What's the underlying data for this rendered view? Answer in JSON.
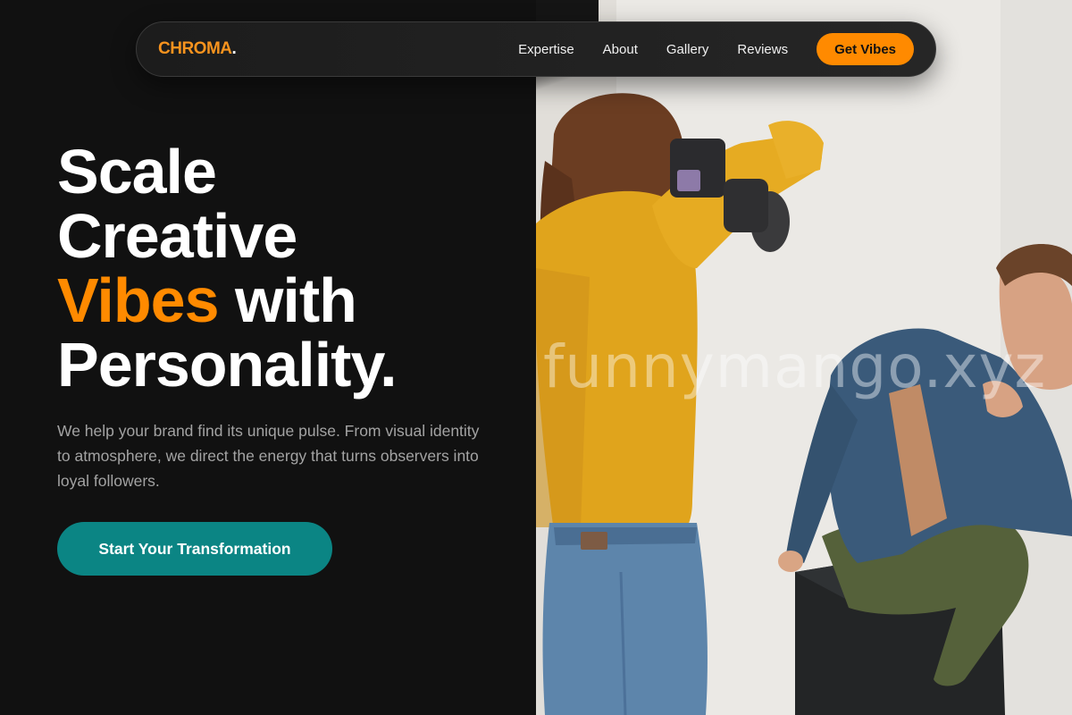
{
  "nav": {
    "logo_text": "CHROMA",
    "logo_dot": ".",
    "links": [
      {
        "label": "Expertise"
      },
      {
        "label": "About"
      },
      {
        "label": "Gallery"
      },
      {
        "label": "Reviews"
      }
    ],
    "cta_label": "Get Vibes"
  },
  "hero": {
    "headline_line1": "Scale",
    "headline_line2": "Creative",
    "headline_accent": "Vibes",
    "headline_line3_rest": " with",
    "headline_line4": "Personality.",
    "subtitle": "We help your brand find its unique pulse. From visual identity to atmosphere, we direct the energy that turns observers into loyal followers.",
    "cta_label": "Start Your Transformation",
    "image_watermark": "funnymango.xyz"
  },
  "colors": {
    "background": "#111111",
    "accent": "#ff8a00",
    "cta_teal": "#0b8584",
    "text_muted": "#a3a3a3"
  }
}
